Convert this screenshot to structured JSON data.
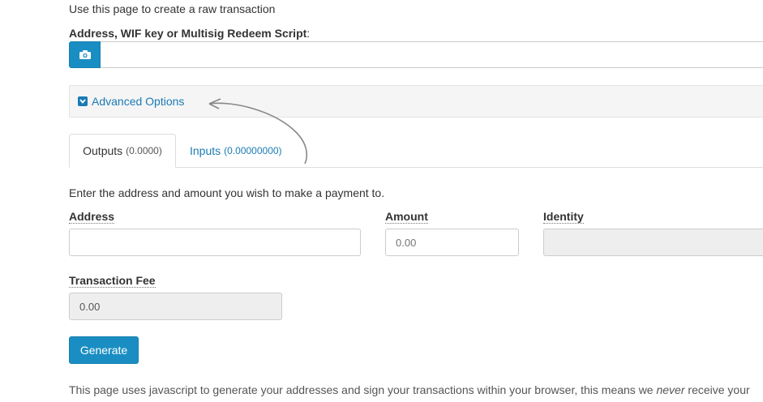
{
  "intro_text": "Use this page to create a raw transaction",
  "address_section": {
    "label": "Address, WIF key or Multisig Redeem Script",
    "colon": ":",
    "input_value": "",
    "camera_icon": "camera-icon"
  },
  "advanced": {
    "label": "Advanced Options",
    "icon": "chevron-down-square-icon"
  },
  "tabs": [
    {
      "label": "Outputs",
      "count": "(0.0000)",
      "active": true
    },
    {
      "label": "Inputs",
      "count": "(0.00000000)",
      "active": false
    }
  ],
  "outputs": {
    "instruction": "Enter the address and amount you wish to make a payment to.",
    "address_label": "Address",
    "address_value": "",
    "amount_label": "Amount",
    "amount_placeholder": "0.00",
    "identity_label": "Identity",
    "identity_value": "",
    "fee_label": "Transaction Fee",
    "fee_value": "0.00"
  },
  "generate_label": "Generate",
  "footer": {
    "text_before": "This page uses javascript to generate your addresses and sign your transactions within your browser, this means we ",
    "emphasis": "never",
    "text_after": " receive your"
  },
  "colors": {
    "primary": "#1a8ec2",
    "link": "#1a7bb5",
    "panel": "#f5f5f5",
    "disabled": "#eeeeee"
  }
}
